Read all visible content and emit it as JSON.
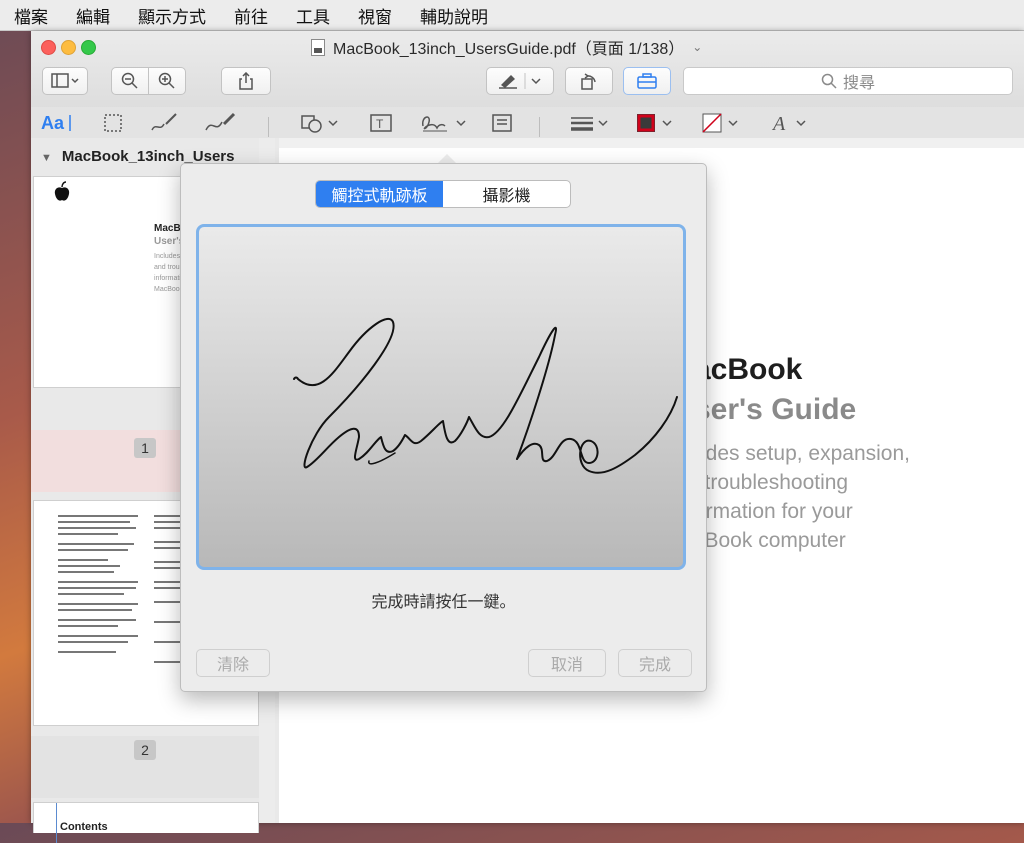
{
  "menubar": {
    "items": [
      "檔案",
      "編輯",
      "顯示方式",
      "前往",
      "工具",
      "視窗",
      "輔助說明"
    ]
  },
  "window": {
    "title": "MacBook_13inch_UsersGuide.pdf（頁面 1/138）",
    "search_placeholder": "搜尋"
  },
  "sidebar": {
    "title": "MacBook_13inch_Users",
    "thumb1": {
      "title": "MacB",
      "subtitle": "User's",
      "lines": [
        "Includes",
        "and troub",
        "informati",
        "MacBook"
      ]
    },
    "page_numbers": [
      "1",
      "2"
    ],
    "thumb3": {
      "heading": "Contents"
    }
  },
  "document": {
    "heading": "acBook",
    "subheading": "ser's Guide",
    "lines": [
      "udes setup, expansion,",
      "l troubleshooting",
      "ormation for your",
      "cBook computer"
    ]
  },
  "signature_dialog": {
    "tabs": [
      "觸控式軌跡板",
      "攝影機"
    ],
    "selected_tab": "觸控式軌跡板",
    "hint": "完成時請按任一鍵。",
    "buttons": {
      "clear": "清除",
      "cancel": "取消",
      "done": "完成"
    }
  },
  "colors": {
    "accent": "#2f7ff0",
    "pad_border": "#7fb3ea",
    "border_color_swatch": "#d0021b"
  }
}
